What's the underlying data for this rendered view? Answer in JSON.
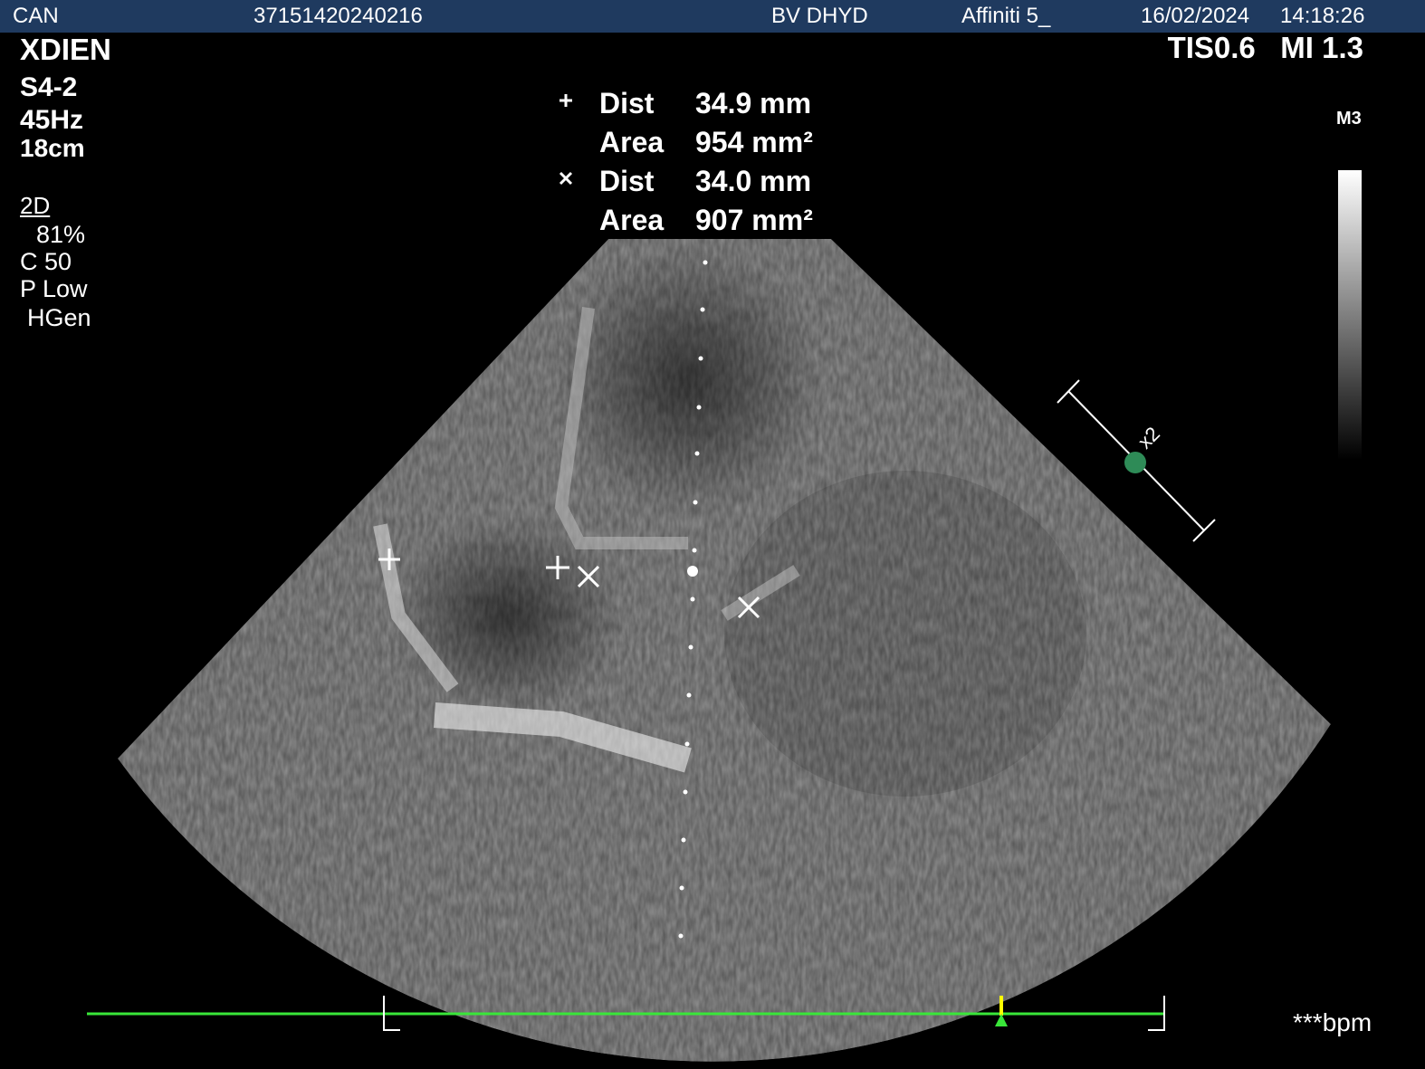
{
  "header": {
    "site": "CAN",
    "patient_id": "37151420240216",
    "operator": "BV DHYD",
    "device": "Affiniti 5_",
    "date": "16/02/2024",
    "time": "14:18:26"
  },
  "left_panel": {
    "preset": "XDIEN",
    "probe": "S4-2",
    "frame_rate": "45Hz",
    "depth": "18cm",
    "mode": "2D",
    "gain": "81%",
    "compression": "C 50",
    "power": "P Low",
    "harmonic": "HGen"
  },
  "right_panel": {
    "thermal_index": "TIS0.6",
    "mechanical_index": "MI 1.3",
    "map": "M3"
  },
  "measurements": [
    {
      "symbol": "plus-marker",
      "label": "Dist",
      "value": "34.9 mm"
    },
    {
      "symbol": "",
      "label": "Area",
      "value": "954 mm²"
    },
    {
      "symbol": "x-marker",
      "label": "Dist",
      "value": "34.0 mm"
    },
    {
      "symbol": "",
      "label": "Area",
      "value": "907 mm²"
    }
  ],
  "zoom_label": "x2",
  "heart_rate": "***bpm",
  "colors": {
    "header_bar": "#1f3a5f",
    "ecg_line": "#39e639",
    "ecg_marker": "#ffff00",
    "zoom_dot": "#2e8b57"
  }
}
